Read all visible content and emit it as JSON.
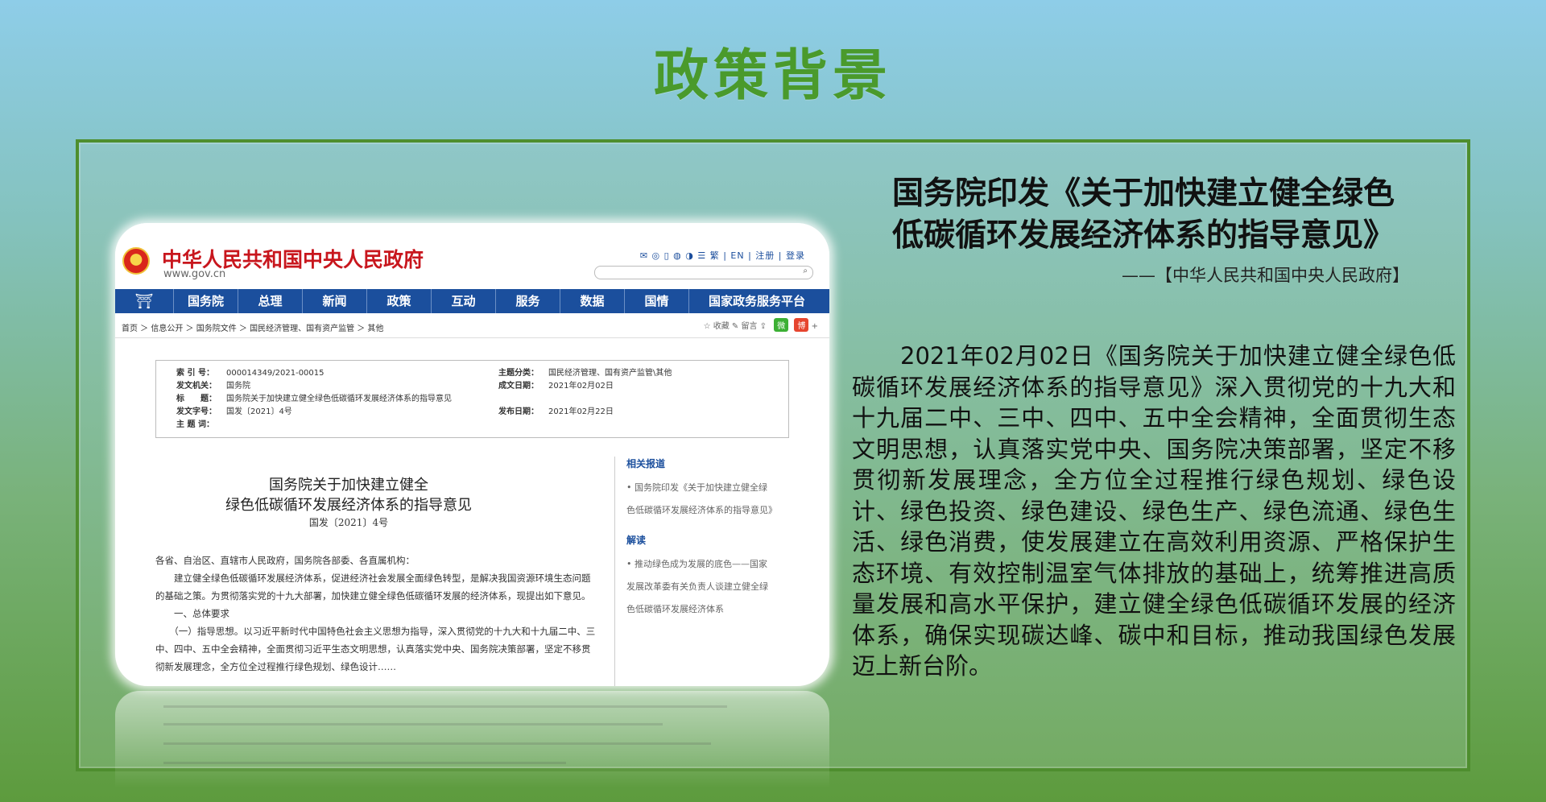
{
  "title": "政策背景",
  "screenshot": {
    "gov_name": "中华人民共和国中央人民政府",
    "gov_url": "www.gov.cn",
    "top_icons": "✉ ◎ ▯ ◍ ◑ ☰ 繁 | EN | 注册 | 登录",
    "nav_items": [
      "国务院",
      "总理",
      "新闻",
      "政策",
      "互动",
      "服务",
      "数据",
      "国情",
      "国家政务服务平台"
    ],
    "breadcrumb": "首页 ＞ 信息公开 ＞ 国务院文件 ＞ 国民经济管理、国有资产监管 ＞ 其他",
    "crumb_tools": "☆ 收藏  ✎ 留言  ⇪",
    "wechat": "微",
    "weibo": "博",
    "plus": "+",
    "info": {
      "index_k": "索 引 号：",
      "index_v": "000014349/2021-00015",
      "category_k": "主题分类：",
      "category_v": "国民经济管理、国有资产监管\\其他",
      "issuer_k": "发文机关：",
      "issuer_v": "国务院",
      "date_written_k": "成文日期：",
      "date_written_v": "2021年02月02日",
      "title_k": "标　　题：",
      "title_v": "国务院关于加快建立健全绿色低碳循环发展经济体系的指导意见",
      "docno_k": "发文字号：",
      "docno_v": "国发〔2021〕4号",
      "date_pub_k": "发布日期：",
      "date_pub_v": "2021年02月22日",
      "subject_k": "主 题 词："
    },
    "doc_title_1": "国务院关于加快建立健全",
    "doc_title_2": "绿色低碳循环发展经济体系的指导意见",
    "doc_number": "国发〔2021〕4号",
    "body": [
      "各省、自治区、直辖市人民政府，国务院各部委、各直属机构：",
      "　　建立健全绿色低碳循环发展经济体系，促进经济社会发展全面绿色转型，是解决我国资源环境生态问题的基础之策。为贯彻落实党的十九大部署，加快建立健全绿色低碳循环发展的经济体系，现提出如下意见。",
      "　　一、总体要求",
      "　　（一）指导思想。以习近平新时代中国特色社会主义思想为指导，深入贯彻党的十九大和十九届二中、三中、四中、五中全会精神，全面贯彻习近平生态文明思想，认真落实党中央、国务院决策部署，坚定不移贯彻新发展理念，全方位全过程推行绿色规划、绿色设计……"
    ],
    "related_head": "相关报道",
    "related_text": "• 国务院印发《关于加快建立健全绿色低碳循环发展经济体系的指导意见》",
    "interpret_head": "解读",
    "interpret_text": "• 推动绿色成为发展的底色——国家发展改革委有关负责人谈建立健全绿色低碳循环发展经济体系"
  },
  "headline_1": "国务院印发《关于加快建立健全绿色",
  "headline_2": "低碳循环发展经济体系的指导意见》",
  "source": "——【中华人民共和国中央人民政府】",
  "body_text": "　　2021年02月02日《国务院关于加快建立健全绿色低碳循环发展经济体系的指导意见》深入贯彻党的十九大和十九届二中、三中、四中、五中全会精神，全面贯彻生态文明思想，认真落实党中央、国务院决策部署，坚定不移贯彻新发展理念，全方位全过程推行绿色规划、绿色设计、绿色投资、绿色建设、绿色生产、绿色流通、绿色生活、绿色消费，使发展建立在高效利用资源、严格保护生态环境、有效控制温室气体排放的基础上，统筹推进高质量发展和高水平保护，建立健全绿色低碳循环发展的经济体系，确保实现碳达峰、碳中和目标，推动我国绿色发展迈上新台阶。"
}
